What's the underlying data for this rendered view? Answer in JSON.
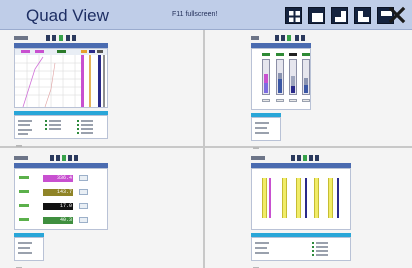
{
  "window": {
    "title": "Quad View",
    "hint": "F11 fullscreen!"
  },
  "toolbar": {
    "layouts": [
      {
        "name": "layout-quad-button",
        "icon": "grid-quad-icon"
      },
      {
        "name": "layout-single-button",
        "icon": "window-single-icon"
      },
      {
        "name": "layout-split-button",
        "icon": "window-split-icon"
      },
      {
        "name": "layout-corner-button",
        "icon": "window-corner-icon"
      },
      {
        "name": "layout-bottom-button",
        "icon": "window-bottom-icon"
      }
    ],
    "close_icon": "close-icon"
  },
  "colors": {
    "title_bar": "#bfcde8",
    "title_text": "#1d2e63",
    "panel_header": "#4a6bb0",
    "info_header": "#29a6d8",
    "magenta_bar": "#c850d0",
    "yellow_col": "#f1ec68",
    "navy_line": "#2a2a8a"
  },
  "panels": {
    "digital": {
      "values": [
        "336.4",
        "143.7",
        "17.0",
        "40.3"
      ]
    }
  }
}
